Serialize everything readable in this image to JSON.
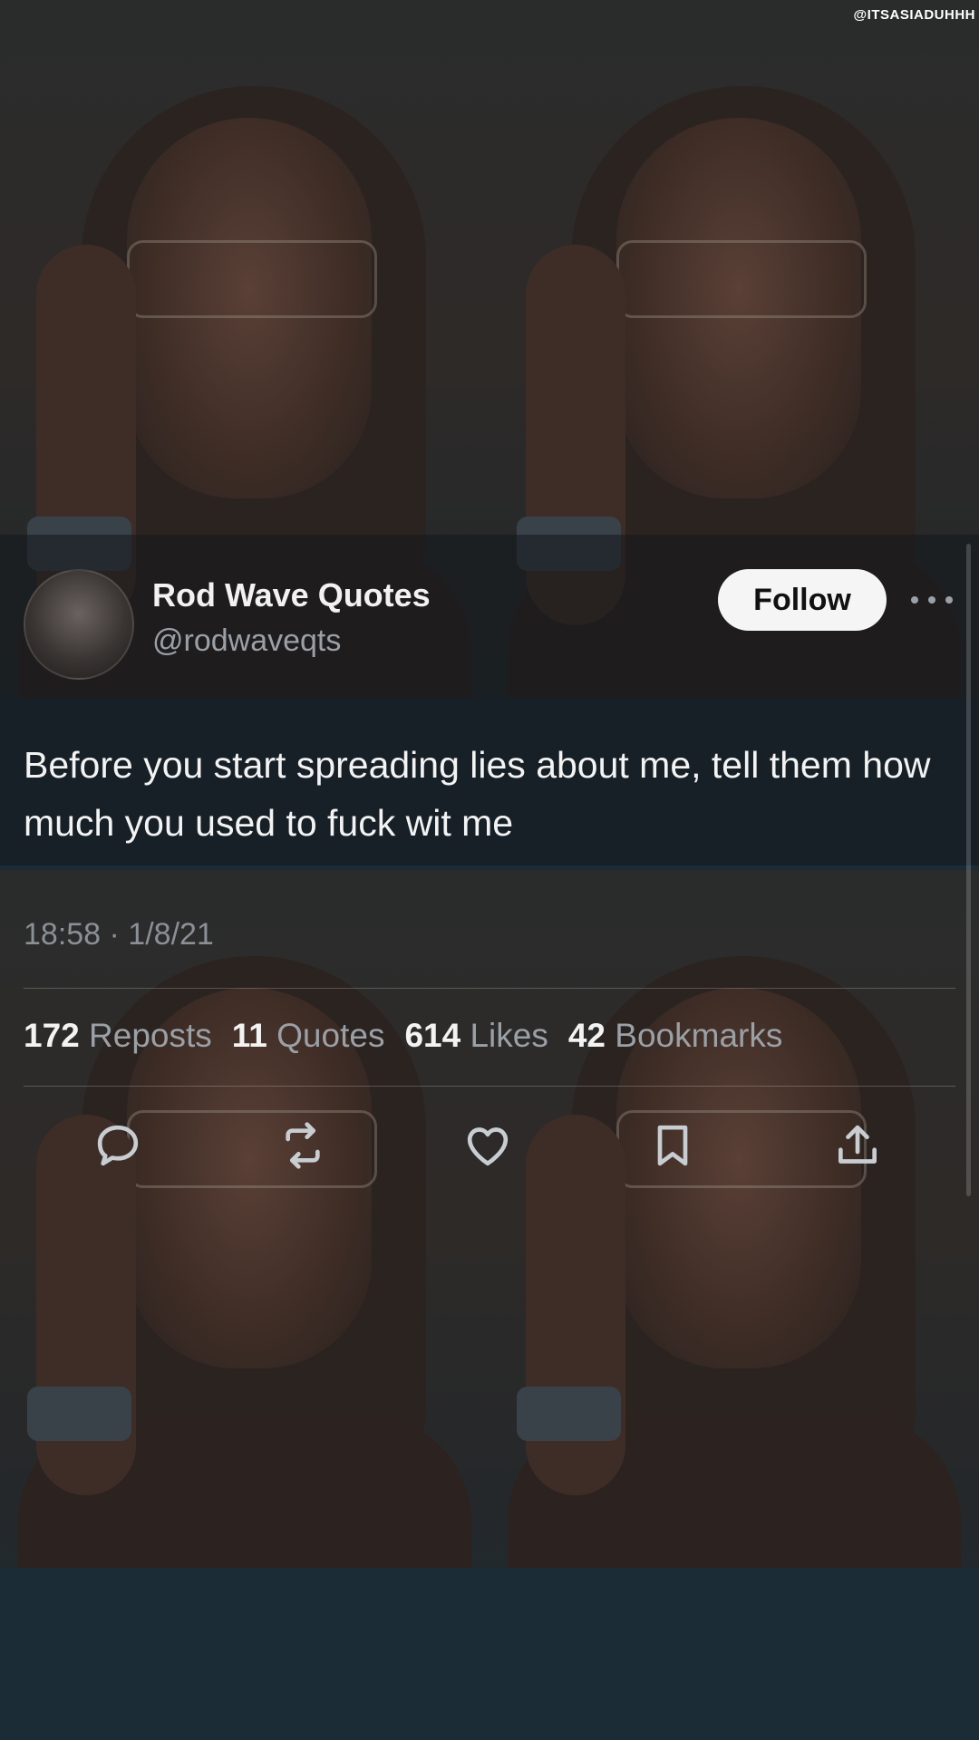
{
  "watermark": "@ITSASIADUHHH",
  "tweet": {
    "display_name": "Rod Wave Quotes",
    "handle": "@rodwaveqts",
    "follow_label": "Follow",
    "text": "Before you start spreading lies about me, tell them how much you used to fuck wit me",
    "timestamp": "18:58 · 1/8/21"
  },
  "stats": [
    {
      "count": "172",
      "label": "Reposts"
    },
    {
      "count": "11",
      "label": "Quotes"
    },
    {
      "count": "614",
      "label": "Likes"
    },
    {
      "count": "42",
      "label": "Bookmarks"
    }
  ],
  "actions": [
    {
      "name": "reply-icon"
    },
    {
      "name": "repost-icon"
    },
    {
      "name": "like-icon"
    },
    {
      "name": "bookmark-icon"
    },
    {
      "name": "share-icon"
    }
  ],
  "icons": {
    "more": "ellipsis-icon",
    "avatar": "avatar"
  },
  "colors": {
    "text_primary": "#f3f3f3",
    "text_secondary": "#9aa0a6",
    "follow_bg": "#f5f5f5"
  }
}
